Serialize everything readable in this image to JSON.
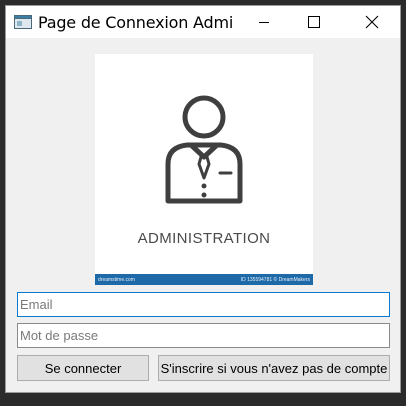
{
  "window": {
    "title": "Page de Connexion Admini..."
  },
  "banner": {
    "caption": "ADMINISTRATION",
    "strip_left": "dreamstime.com",
    "strip_right": "ID 135594781 © DreamMakers"
  },
  "form": {
    "email_placeholder": "Email",
    "password_placeholder": "Mot de passe",
    "login_label": "Se connecter",
    "register_label": "S'inscrire si vous n'avez pas de compte"
  },
  "icons": {
    "app": "window-icon",
    "minimize": "minimize-icon",
    "maximize": "maximize-icon",
    "close": "close-icon",
    "banner": "administrator-person-icon"
  },
  "colors": {
    "window_bg": "#f0f0f0",
    "titlebar_bg": "#ffffff",
    "focus_border": "#0a7ad0",
    "strip_bg": "#1e6aa8"
  }
}
